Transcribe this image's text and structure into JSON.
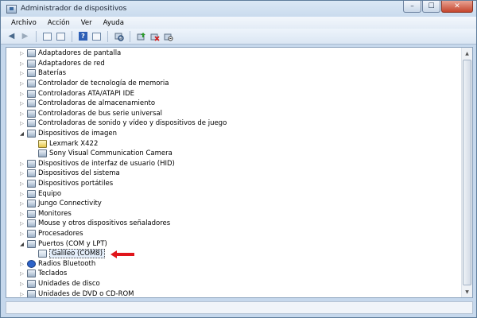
{
  "window": {
    "title": "Administrador de dispositivos"
  },
  "titlebar": {
    "minimize": "–",
    "maximize": "☐",
    "close": "✕"
  },
  "menu": [
    "Archivo",
    "Acción",
    "Ver",
    "Ayuda"
  ],
  "toolbar": {
    "back": "◀",
    "forward": "▶",
    "help": "?"
  },
  "tree": [
    {
      "label": "Adaptadores de pantalla",
      "level": 0,
      "state": "closed",
      "icon": "display-icon"
    },
    {
      "label": "Adaptadores de red",
      "level": 0,
      "state": "closed",
      "icon": "network-icon"
    },
    {
      "label": "Baterías",
      "level": 0,
      "state": "closed",
      "icon": "battery-icon"
    },
    {
      "label": "Controlador de tecnología de memoria",
      "level": 0,
      "state": "closed",
      "icon": "memory-icon"
    },
    {
      "label": "Controladoras ATA/ATAPI IDE",
      "level": 0,
      "state": "closed",
      "icon": "ide-icon"
    },
    {
      "label": "Controladoras de almacenamiento",
      "level": 0,
      "state": "closed",
      "icon": "storage-icon"
    },
    {
      "label": "Controladoras de bus serie universal",
      "level": 0,
      "state": "closed",
      "icon": "usb-icon"
    },
    {
      "label": "Controladoras de sonido y vídeo y dispositivos de juego",
      "level": 0,
      "state": "closed",
      "icon": "sound-icon"
    },
    {
      "label": "Dispositivos de imagen",
      "level": 0,
      "state": "open",
      "icon": "imaging-icon"
    },
    {
      "label": "Lexmark X422",
      "level": 1,
      "state": "none",
      "icon": "warning-device-icon"
    },
    {
      "label": "Sony Visual Communication Camera",
      "level": 1,
      "state": "none",
      "icon": "camera-icon"
    },
    {
      "label": "Dispositivos de interfaz de usuario (HID)",
      "level": 0,
      "state": "closed",
      "icon": "hid-icon"
    },
    {
      "label": "Dispositivos del sistema",
      "level": 0,
      "state": "closed",
      "icon": "system-icon"
    },
    {
      "label": "Dispositivos portátiles",
      "level": 0,
      "state": "closed",
      "icon": "portable-icon"
    },
    {
      "label": "Equipo",
      "level": 0,
      "state": "closed",
      "icon": "computer-icon"
    },
    {
      "label": "Jungo Connectivity",
      "level": 0,
      "state": "closed",
      "icon": "jungo-icon"
    },
    {
      "label": "Monitores",
      "level": 0,
      "state": "closed",
      "icon": "monitor-icon"
    },
    {
      "label": "Mouse y otros dispositivos señaladores",
      "level": 0,
      "state": "closed",
      "icon": "mouse-icon"
    },
    {
      "label": "Procesadores",
      "level": 0,
      "state": "closed",
      "icon": "processor-icon"
    },
    {
      "label": "Puertos (COM y LPT)",
      "level": 0,
      "state": "open",
      "icon": "port-icon"
    },
    {
      "label": "Galileo (COM8)",
      "level": 1,
      "state": "none",
      "icon": "com-port-icon",
      "selected": true,
      "pointer": true
    },
    {
      "label": "Radios Bluetooth",
      "level": 0,
      "state": "closed",
      "icon": "bluetooth-icon"
    },
    {
      "label": "Teclados",
      "level": 0,
      "state": "closed",
      "icon": "keyboard-icon"
    },
    {
      "label": "Unidades de disco",
      "level": 0,
      "state": "closed",
      "icon": "disk-icon"
    },
    {
      "label": "Unidades de DVD o CD-ROM",
      "level": 0,
      "state": "closed",
      "icon": "dvd-icon"
    }
  ],
  "scrollbar": {
    "up": "▲",
    "down": "▼"
  },
  "colors": {
    "pointer_arrow": "#e0151b",
    "bluetooth": "#2d63c8"
  }
}
